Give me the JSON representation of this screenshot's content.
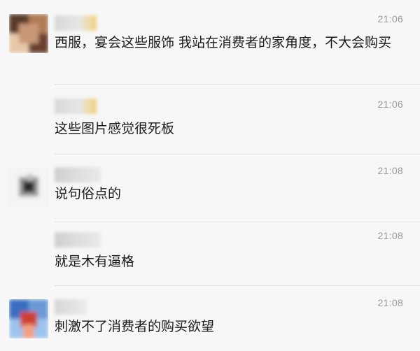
{
  "messages": [
    {
      "time": "21:06",
      "text": "西服，宴会这些服饰 我站在消费者的家角度，不大会购买",
      "avatar_colors": [
        "#5a3a2a",
        "#a07050",
        "#e8c8a8",
        "#7a5040"
      ],
      "name_colors": [
        "#d8d8d8",
        "#e6e6e6",
        "#f2d27a"
      ]
    },
    {
      "time": "21:06",
      "text": "这些图片感觉很死板",
      "avatar_colors": [],
      "name_colors": [
        "#d8d8d8",
        "#e6e6e6",
        "#f2d27a"
      ]
    },
    {
      "time": "21:08",
      "text": "说句俗点的",
      "avatar_colors": [
        "#2a2a2a",
        "#7a7a7a",
        "#d0d0d0",
        "#f4f4f4"
      ],
      "name_colors": [
        "#cfcfcf",
        "#dedede",
        "#e9e9e9"
      ]
    },
    {
      "time": "21:08",
      "text": "就是木有逼格",
      "avatar_colors": [],
      "name_colors": [
        "#cfcfcf",
        "#dedede",
        "#e9e9e9"
      ]
    },
    {
      "time": "21:08",
      "text": "刺激不了消费者的购买欲望",
      "avatar_colors": [
        "#3a6ec0",
        "#d04030",
        "#f0a080",
        "#9ec4ee"
      ],
      "name_colors": [
        "#d6d6d6",
        "#e3e3e3",
        "#ececec"
      ]
    }
  ]
}
